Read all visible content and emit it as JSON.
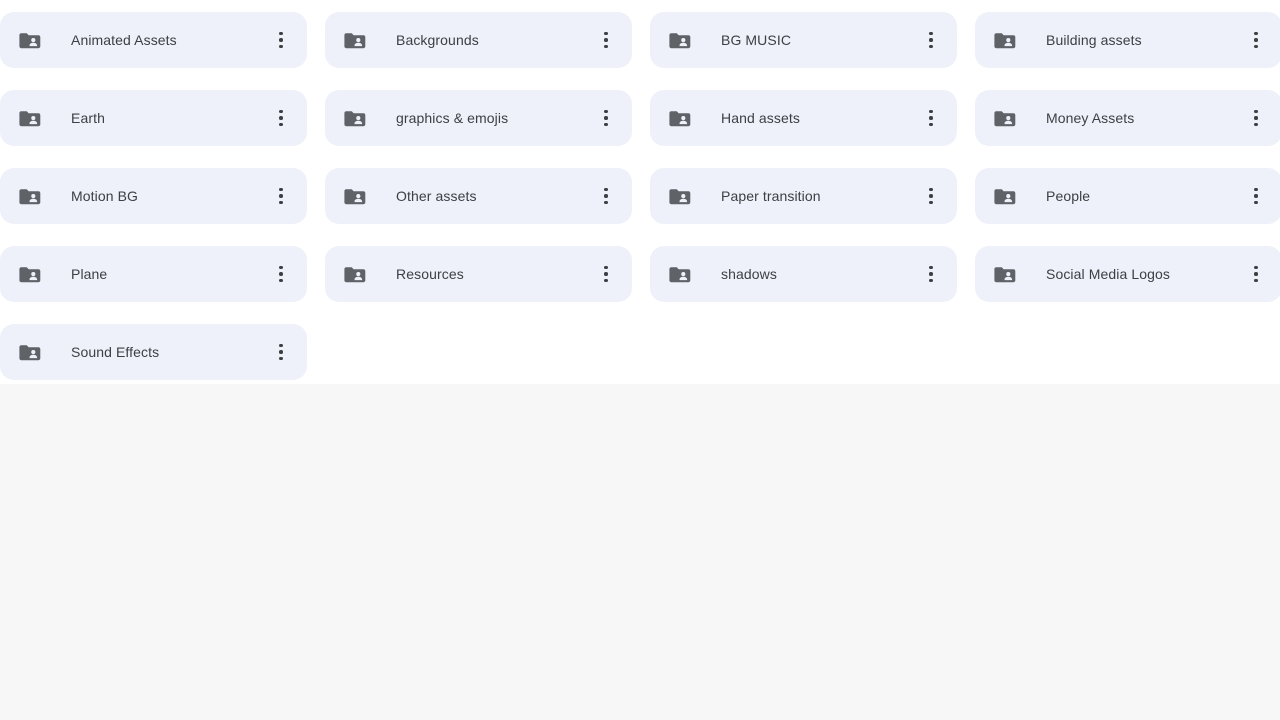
{
  "theme": {
    "page_background": "#f7f7f8",
    "panel_background": "#ffffff",
    "card_background": "#eef1f9",
    "text_color": "#3c4043",
    "icon_color": "#5f6368"
  },
  "grid": {
    "columns": 4,
    "item_icon": "shared-folder-icon",
    "overflow_icon": "more-vert-icon",
    "overflow_label": "More actions",
    "items": [
      {
        "name": "Animated Assets"
      },
      {
        "name": "Backgrounds"
      },
      {
        "name": "BG MUSIC"
      },
      {
        "name": "Building assets"
      },
      {
        "name": "Earth"
      },
      {
        "name": "graphics & emojis"
      },
      {
        "name": "Hand assets"
      },
      {
        "name": "Money Assets"
      },
      {
        "name": "Motion BG"
      },
      {
        "name": "Other assets"
      },
      {
        "name": "Paper transition"
      },
      {
        "name": "People"
      },
      {
        "name": "Plane"
      },
      {
        "name": "Resources"
      },
      {
        "name": "shadows"
      },
      {
        "name": "Social Media Logos"
      },
      {
        "name": "Sound Effects"
      }
    ]
  }
}
